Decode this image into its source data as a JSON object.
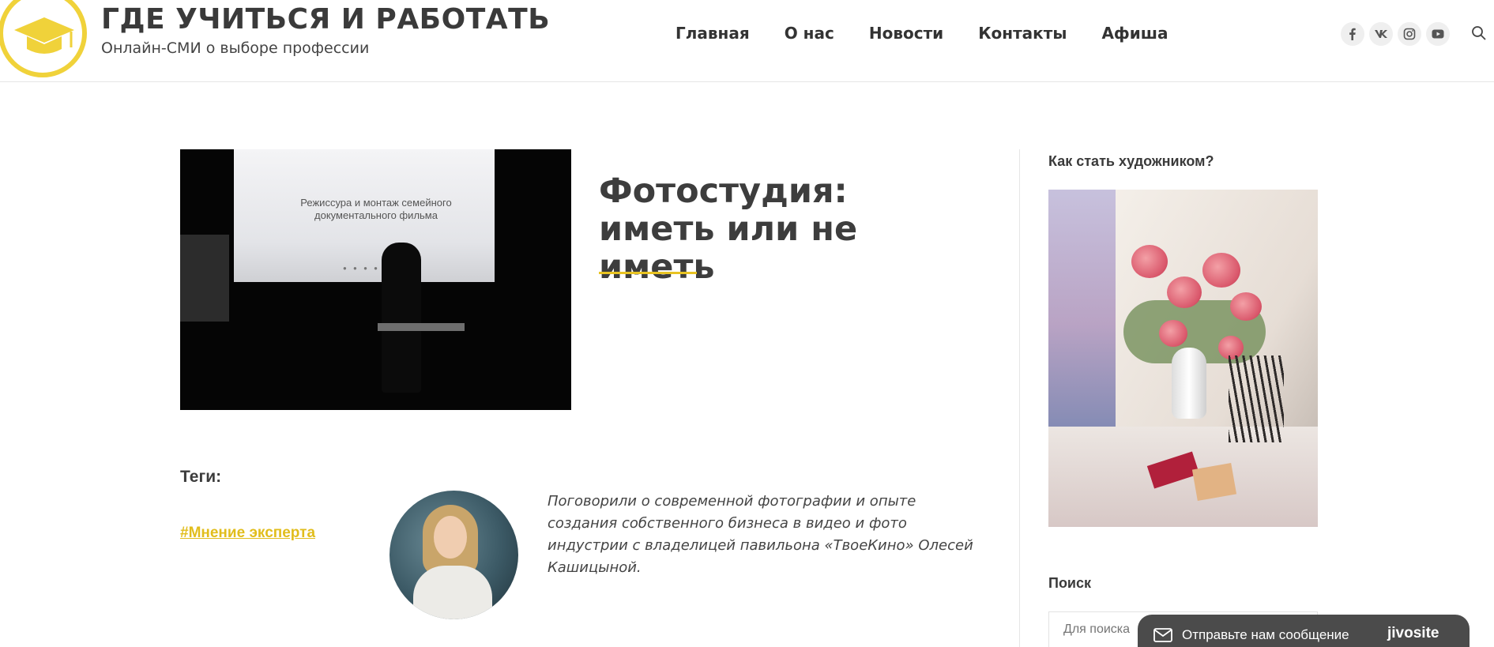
{
  "header": {
    "site_title": "ГДЕ УЧИТЬСЯ И РАБОТАТЬ",
    "site_subtitle": "Онлайн-СМИ о выборе профессии",
    "nav": [
      "Главная",
      "О нас",
      "Новости",
      "Контакты",
      "Афиша"
    ],
    "social_icons": [
      "facebook-icon",
      "vk-icon",
      "instagram-icon",
      "youtube-icon"
    ],
    "search_icon": "search-icon"
  },
  "article": {
    "image_caption": "Режиссура и монтаж семейного документального фильма",
    "title": "Фотостудия: иметь или не иметь",
    "tags_label": "Теги:",
    "tag": "#Мнение эксперта",
    "lead": "Поговорили о современной фотографии и опыте создания собственного бизнеса в видео и фото индустрии с владелицей павильона «ТвоеКино» Олесей Кашицыной."
  },
  "sidebar": {
    "widget_title": "Как стать художником?",
    "search_title": "Поиск",
    "search_placeholder": "Для поиска"
  },
  "chat": {
    "message": "Отправьте нам сообщение",
    "brand": "jivosite"
  },
  "colors": {
    "accent": "#e8c322",
    "text": "#3a3a3a",
    "chat_bg": "#4b4b4b"
  }
}
